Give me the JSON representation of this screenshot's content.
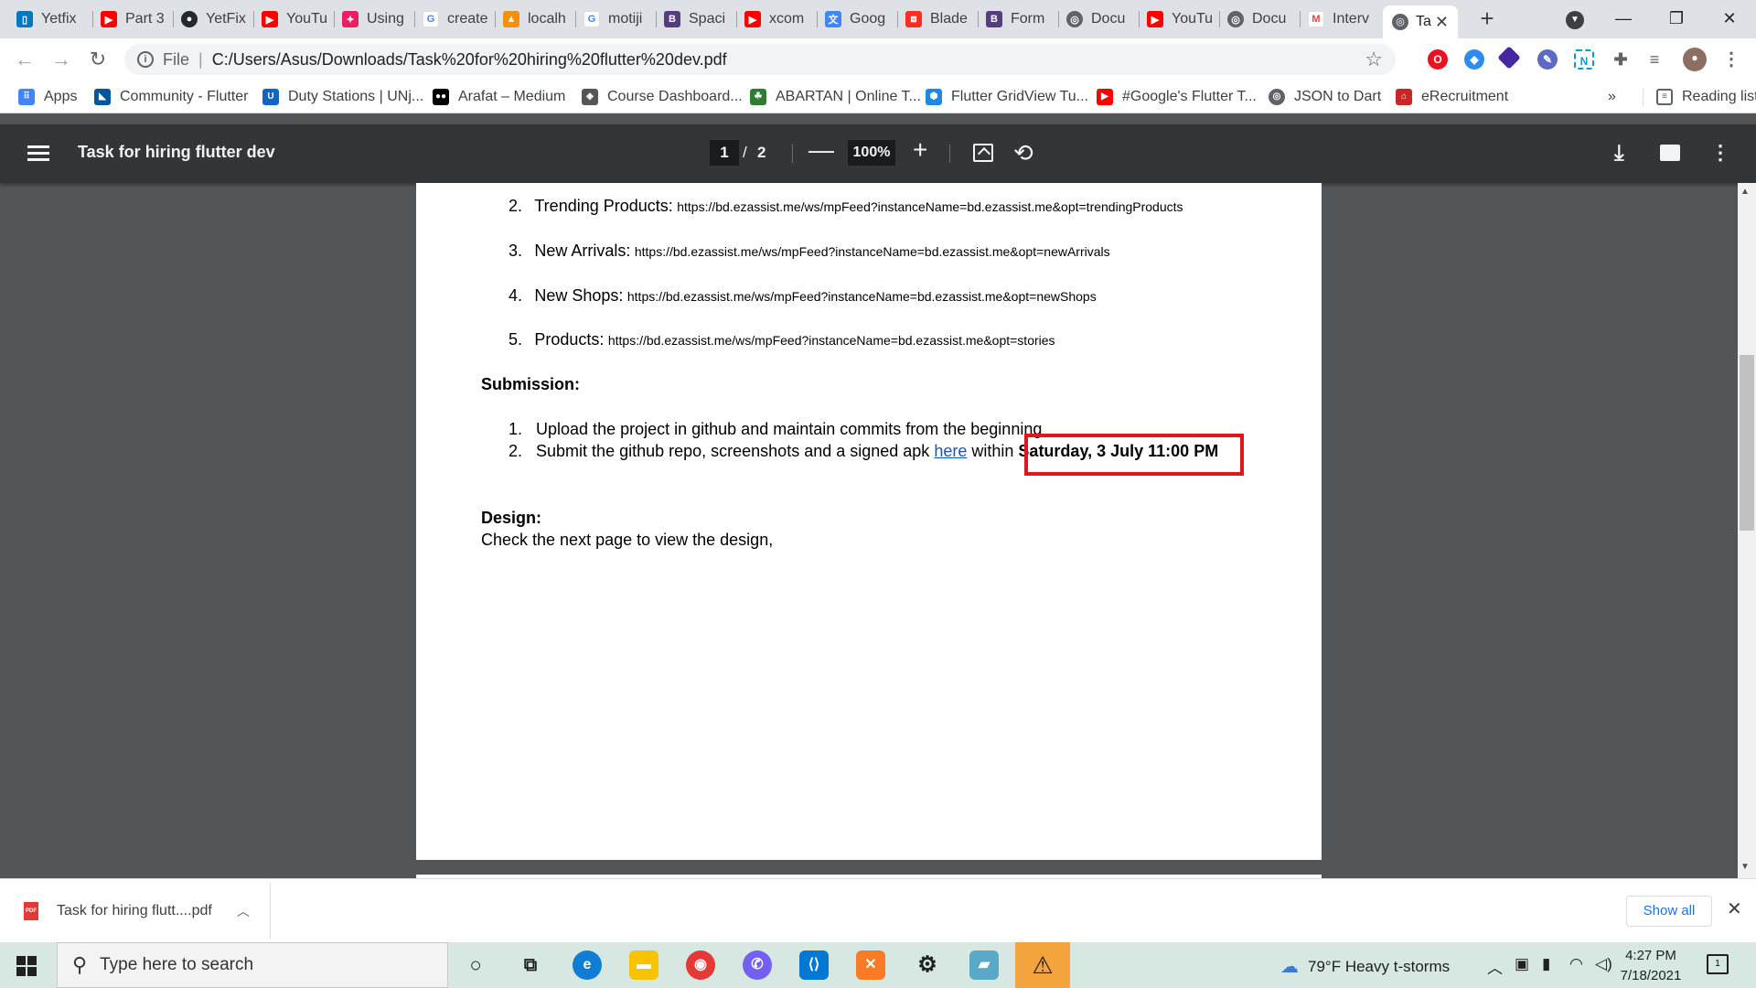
{
  "tabs": [
    {
      "title": "Yetfix",
      "icon": "trello-icon",
      "color": "#0079bf"
    },
    {
      "title": "Part 3",
      "icon": "youtube-icon",
      "color": "#ff0000"
    },
    {
      "title": "YetFix",
      "icon": "github-icon",
      "color": "#24292e"
    },
    {
      "title": "YouTu",
      "icon": "youtube-icon",
      "color": "#ff0000"
    },
    {
      "title": "Using",
      "icon": "app-icon",
      "color": "#e91e63"
    },
    {
      "title": "create",
      "icon": "google-icon",
      "color": "#4285f4"
    },
    {
      "title": "localh",
      "icon": "phpmyadmin-icon",
      "color": "#f29111"
    },
    {
      "title": "motiji",
      "icon": "google-icon",
      "color": "#4285f4"
    },
    {
      "title": "Spaci",
      "icon": "bootstrap-icon",
      "color": "#563d7c"
    },
    {
      "title": "xcom",
      "icon": "youtube-icon",
      "color": "#ff0000"
    },
    {
      "title": "Goog",
      "icon": "translate-icon",
      "color": "#4285f4"
    },
    {
      "title": "Blade",
      "icon": "laravel-icon",
      "color": "#ff2d20"
    },
    {
      "title": "Form",
      "icon": "bootstrap-icon",
      "color": "#563d7c"
    },
    {
      "title": "Docu",
      "icon": "globe-icon",
      "color": "#5f6368"
    },
    {
      "title": "YouTu",
      "icon": "youtube-icon",
      "color": "#ff0000"
    },
    {
      "title": "Docu",
      "icon": "globe-icon",
      "color": "#5f6368"
    },
    {
      "title": "Interv",
      "icon": "gmail-icon",
      "color": "#ea4335"
    }
  ],
  "active_tab": {
    "title": "Ta",
    "close": "✕"
  },
  "new_tab": "+",
  "window": {
    "minimize": "—",
    "maximize": "❐",
    "close": "✕"
  },
  "address": {
    "scheme": "File",
    "url": "C:/Users/Asus/Downloads/Task%20for%20hiring%20flutter%20dev.pdf"
  },
  "bookmarks": [
    {
      "label": "Apps",
      "color": "#4285f4"
    },
    {
      "label": "Community - Flutter",
      "color": "#02569b"
    },
    {
      "label": "Duty Stations | UNj...",
      "color": "#1565c0"
    },
    {
      "label": "Arafat – Medium",
      "color": "#000000"
    },
    {
      "label": "Course Dashboard...",
      "color": "#555555"
    },
    {
      "label": "ABARTAN | Online T...",
      "color": "#2e7d32"
    },
    {
      "label": "Flutter GridView Tu...",
      "color": "#1e88e5"
    },
    {
      "label": "#Google's Flutter T...",
      "color": "#ff0000"
    },
    {
      "label": "JSON to Dart",
      "color": "#5f6368"
    },
    {
      "label": "eRecruitment",
      "color": "#c62828"
    }
  ],
  "bookmarks_overflow": "»",
  "reading_list": "Reading list",
  "pdf": {
    "title": "Task for hiring flutter dev",
    "page_current": "1",
    "page_separator": "/",
    "page_total": "2",
    "zoom": "100%",
    "zoom_out": "—",
    "zoom_in": "+"
  },
  "document": {
    "list_items": [
      {
        "num": "2.",
        "label": "Trending Products:",
        "url": "https://bd.ezassist.me/ws/mpFeed?instanceName=bd.ezassist.me&opt=trendingProducts"
      },
      {
        "num": "3.",
        "label": "New Arrivals:",
        "url": "https://bd.ezassist.me/ws/mpFeed?instanceName=bd.ezassist.me&opt=newArrivals"
      },
      {
        "num": "4.",
        "label": "New Shops:",
        "url": "https://bd.ezassist.me/ws/mpFeed?instanceName=bd.ezassist.me&opt=newShops"
      },
      {
        "num": "5.",
        "label": "Products:",
        "url": "https://bd.ezassist.me/ws/mpFeed?instanceName=bd.ezassist.me&opt=stories"
      }
    ],
    "submission_heading": "Submission:",
    "submission_items": [
      {
        "num": "1.",
        "text": "Upload the project in github and maintain commits from the beginning"
      },
      {
        "num": "2.",
        "text": "Submit the github repo, screenshots and a signed apk",
        "link": "here",
        "after": "within",
        "deadline": "Saturday, 3 July 11:00 PM"
      }
    ],
    "design_heading": "Design:",
    "design_text": "Check the next page to view the design,"
  },
  "download": {
    "filename": "Task for hiring flutt....pdf",
    "show_all": "Show all",
    "close": "✕"
  },
  "taskbar": {
    "search_placeholder": "Type here to search",
    "weather": "79°F  Heavy t-storms",
    "time": "4:27 PM",
    "date": "7/18/2021",
    "notification_count": "1"
  }
}
